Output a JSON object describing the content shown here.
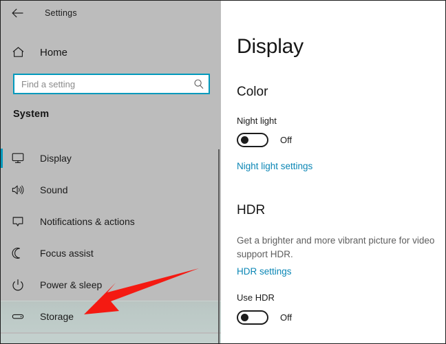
{
  "window": {
    "app_title": "Settings",
    "back_icon": "back-arrow-icon"
  },
  "sidebar": {
    "home_label": "Home",
    "home_icon": "home-icon",
    "search": {
      "placeholder": "Find a setting",
      "value": "",
      "icon": "search-icon",
      "border_color": "#0099BC"
    },
    "section_title": "System",
    "accent_color": "#0099BC",
    "items": [
      {
        "label": "Display",
        "icon": "monitor-icon",
        "selected": true,
        "hovered": false
      },
      {
        "label": "Sound",
        "icon": "speaker-icon",
        "selected": false,
        "hovered": false
      },
      {
        "label": "Notifications & actions",
        "icon": "chat-bubble-icon",
        "selected": false,
        "hovered": false
      },
      {
        "label": "Focus assist",
        "icon": "moon-icon",
        "selected": false,
        "hovered": false
      },
      {
        "label": "Power & sleep",
        "icon": "power-icon",
        "selected": false,
        "hovered": false
      },
      {
        "label": "Storage",
        "icon": "disk-drive-icon",
        "selected": false,
        "hovered": true
      }
    ]
  },
  "content": {
    "page_title": "Display",
    "color_section": {
      "heading": "Color",
      "night_light_label": "Night light",
      "night_light_state": "Off",
      "night_light_link": "Night light settings"
    },
    "hdr_section": {
      "heading": "HDR",
      "description": "Get a brighter and more vibrant picture for video\nsupport HDR.",
      "hdr_link": "HDR settings",
      "use_hdr_label": "Use HDR",
      "use_hdr_state": "Off"
    },
    "link_color": "#0A86B5"
  },
  "annotation": {
    "arrow_color": "#F41A12",
    "arrow_points_to": "Storage"
  }
}
